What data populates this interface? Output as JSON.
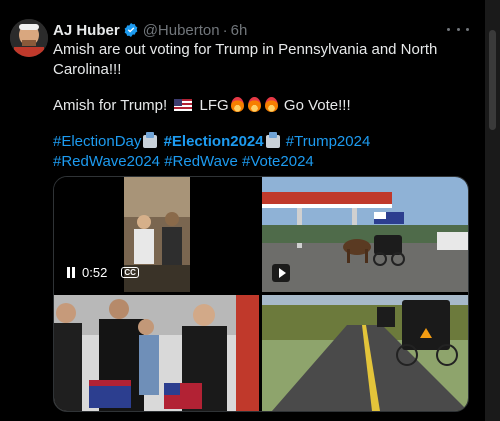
{
  "author": {
    "name": "AJ Huber",
    "handle": "@Huberton",
    "separator": "·",
    "time": "6h",
    "verified_icon": "verified-badge-icon",
    "verified_color": "#1d9bf0"
  },
  "tweet": {
    "line1": "Amish are out voting for Trump in Pennsylvania and North",
    "line2": "Carolina!!!",
    "line3_prefix": "Amish for Trump!",
    "line3_mid": "LFG",
    "line3_suffix": "Go Vote!!!",
    "hashtags": {
      "election_day": "#ElectionDay",
      "election2024": "#Election2024",
      "trump2024": "#Trump2024",
      "redwave2024": "#RedWave2024",
      "redwave": "#RedWave",
      "vote2024": "#Vote2024"
    }
  },
  "media": {
    "video": {
      "duration": "0:52",
      "cc_label": "CC",
      "pause_icon": "pause-icon",
      "captions_icon": "closed-captions-icon"
    },
    "gif_play_icon": "play-icon"
  },
  "colors": {
    "link": "#1d9bf0",
    "muted": "#71767b",
    "text": "#e7e9ea",
    "background": "#000000"
  }
}
